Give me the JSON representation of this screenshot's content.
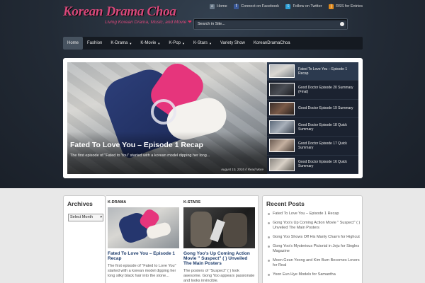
{
  "site": {
    "title": "Korean Drama Choa",
    "tagline": "Living Korean Drama, Music, and Movie"
  },
  "top_links": [
    {
      "label": "Home",
      "icon": "home-icon"
    },
    {
      "label": "Connect on Facebook",
      "icon": "facebook-icon"
    },
    {
      "label": "Follow on Twitter",
      "icon": "twitter-icon"
    },
    {
      "label": "RSS for Entries",
      "icon": "rss-icon"
    }
  ],
  "search": {
    "placeholder": "Search in Site..."
  },
  "nav": [
    {
      "label": "Home",
      "active": true,
      "dropdown": false
    },
    {
      "label": "Fashion",
      "active": false,
      "dropdown": false
    },
    {
      "label": "K-Drama",
      "active": false,
      "dropdown": true
    },
    {
      "label": "K-Movie",
      "active": false,
      "dropdown": true
    },
    {
      "label": "K-Pop",
      "active": false,
      "dropdown": true
    },
    {
      "label": "K-Stars",
      "active": false,
      "dropdown": true
    },
    {
      "label": "Variety Show",
      "active": false,
      "dropdown": false
    },
    {
      "label": "KoreanDramaChoa",
      "active": false,
      "dropdown": false
    }
  ],
  "featured": {
    "title": "Fated To Love You – Episode 1 Recap",
    "excerpt": "The first episode of \"Fated to You\" started with a korean model dipping her long...",
    "date": "August 10, 2015",
    "read_more": "Read More"
  },
  "slider_items": [
    {
      "title": "Fated To Love You – Episode 1 Recap",
      "active": true
    },
    {
      "title": "Good Doctor Episode 20 Summary (Final)",
      "active": false
    },
    {
      "title": "Good Doctor Episode 19 Summary",
      "active": false
    },
    {
      "title": "Good Doctor Episode 18 Quick Summary",
      "active": false
    },
    {
      "title": "Good Doctor Episode 17 Quick Summary",
      "active": false
    },
    {
      "title": "Good Doctor Episode 16 Quick Summary",
      "active": false
    }
  ],
  "archives": {
    "title": "Archives",
    "select_value": "Select Month"
  },
  "columns": [
    {
      "category": "K-DRAMA",
      "title": "Fated To Love You – Episode 1 Recap",
      "excerpt": "The first episode of \"Fated to Love You\" started with a korean model dipping her long silky black hair into the stone..."
    },
    {
      "category": "K-STARS",
      "title": "Gong Yoo's Up Coming Action Movie \" Suspect\" (   ) Unveiled The Main Posters",
      "excerpt": "The posters of \"Suspect\" (   ) look awesome. Gong Yoo appears passionate and looks invincible."
    }
  ],
  "recent_posts": {
    "title": "Recent Posts",
    "items": [
      "Fated To Love You – Episode 1 Recap",
      "Gong Yoo's Up Coming Action Movie \" Suspect\" (   ) Unveiled The Main Posters",
      "Gong Yoo Shows Off His Manly Charm for Highcut",
      "Gong Yoo's Mysterious Pictorial in Jeju for Singles Magazine",
      "Moon Geun Yeong and Kim Bum Becomes Lovers for Real",
      "Yoon Eun Hye Models for Samantha"
    ]
  },
  "colors": {
    "brand": "#d8487a",
    "link": "#1b3a6a"
  }
}
